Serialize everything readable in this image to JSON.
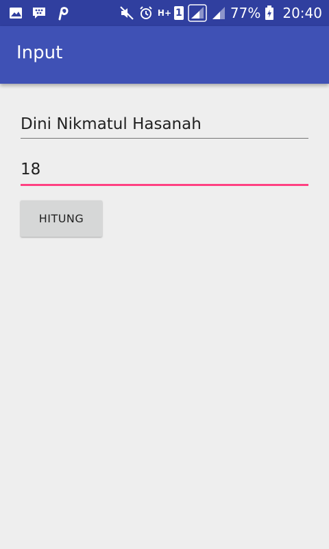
{
  "status_bar": {
    "battery_percent": "77%",
    "time": "20:40",
    "sim_label": "1",
    "network_type": "H+",
    "icons": [
      "gallery-icon",
      "bbm-icon",
      "pinterest-icon",
      "mute-icon",
      "alarm-icon",
      "network-type-icon",
      "sim-icon",
      "signal-icon",
      "signal-icon",
      "battery-charging-icon"
    ]
  },
  "app_bar": {
    "title": "Input"
  },
  "form": {
    "name_value": "Dini Nikmatul Hasanah",
    "age_value": "18",
    "button_label": "HITUNG"
  },
  "colors": {
    "status_bar": "#303f9f",
    "app_bar": "#3f51b5",
    "accent": "#ff4081",
    "background": "#eeeeee",
    "button": "#d6d7d7"
  }
}
